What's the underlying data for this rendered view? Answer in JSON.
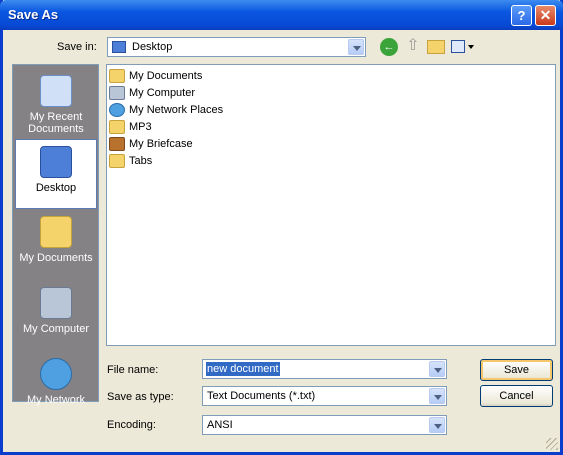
{
  "window": {
    "title": "Save As",
    "help_icon": "help-icon",
    "close_icon": "close-icon"
  },
  "toolbar": {
    "save_in_label": "Save in:",
    "save_in_value": "Desktop",
    "icons": [
      "back-icon",
      "up-folder-icon",
      "new-folder-icon",
      "views-menu-icon"
    ]
  },
  "places": [
    {
      "label": "My Recent Documents",
      "icon": "recent-documents-icon",
      "selected": false
    },
    {
      "label": "Desktop",
      "icon": "desktop-icon",
      "selected": true
    },
    {
      "label": "My Documents",
      "icon": "my-documents-icon",
      "selected": false
    },
    {
      "label": "My Computer",
      "icon": "my-computer-icon",
      "selected": false
    },
    {
      "label": "My Network",
      "icon": "my-network-icon",
      "selected": false
    }
  ],
  "files": [
    {
      "name": "My Documents",
      "icon": "my-documents-icon"
    },
    {
      "name": "My Computer",
      "icon": "my-computer-icon"
    },
    {
      "name": "My Network Places",
      "icon": "network-places-icon"
    },
    {
      "name": "MP3",
      "icon": "folder-icon"
    },
    {
      "name": "My Briefcase",
      "icon": "briefcase-icon"
    },
    {
      "name": "Tabs",
      "icon": "folder-icon"
    }
  ],
  "form": {
    "file_name_label": "File name:",
    "file_name_value": "new document",
    "save_as_type_label": "Save as type:",
    "save_as_type_value": "Text Documents (*.txt)",
    "encoding_label": "Encoding:",
    "encoding_value": "ANSI"
  },
  "buttons": {
    "save": "Save",
    "cancel": "Cancel"
  },
  "colors": {
    "titlebar": "#0a56e0",
    "dialog_bg": "#ece9d8",
    "selection": "#316ac5"
  }
}
